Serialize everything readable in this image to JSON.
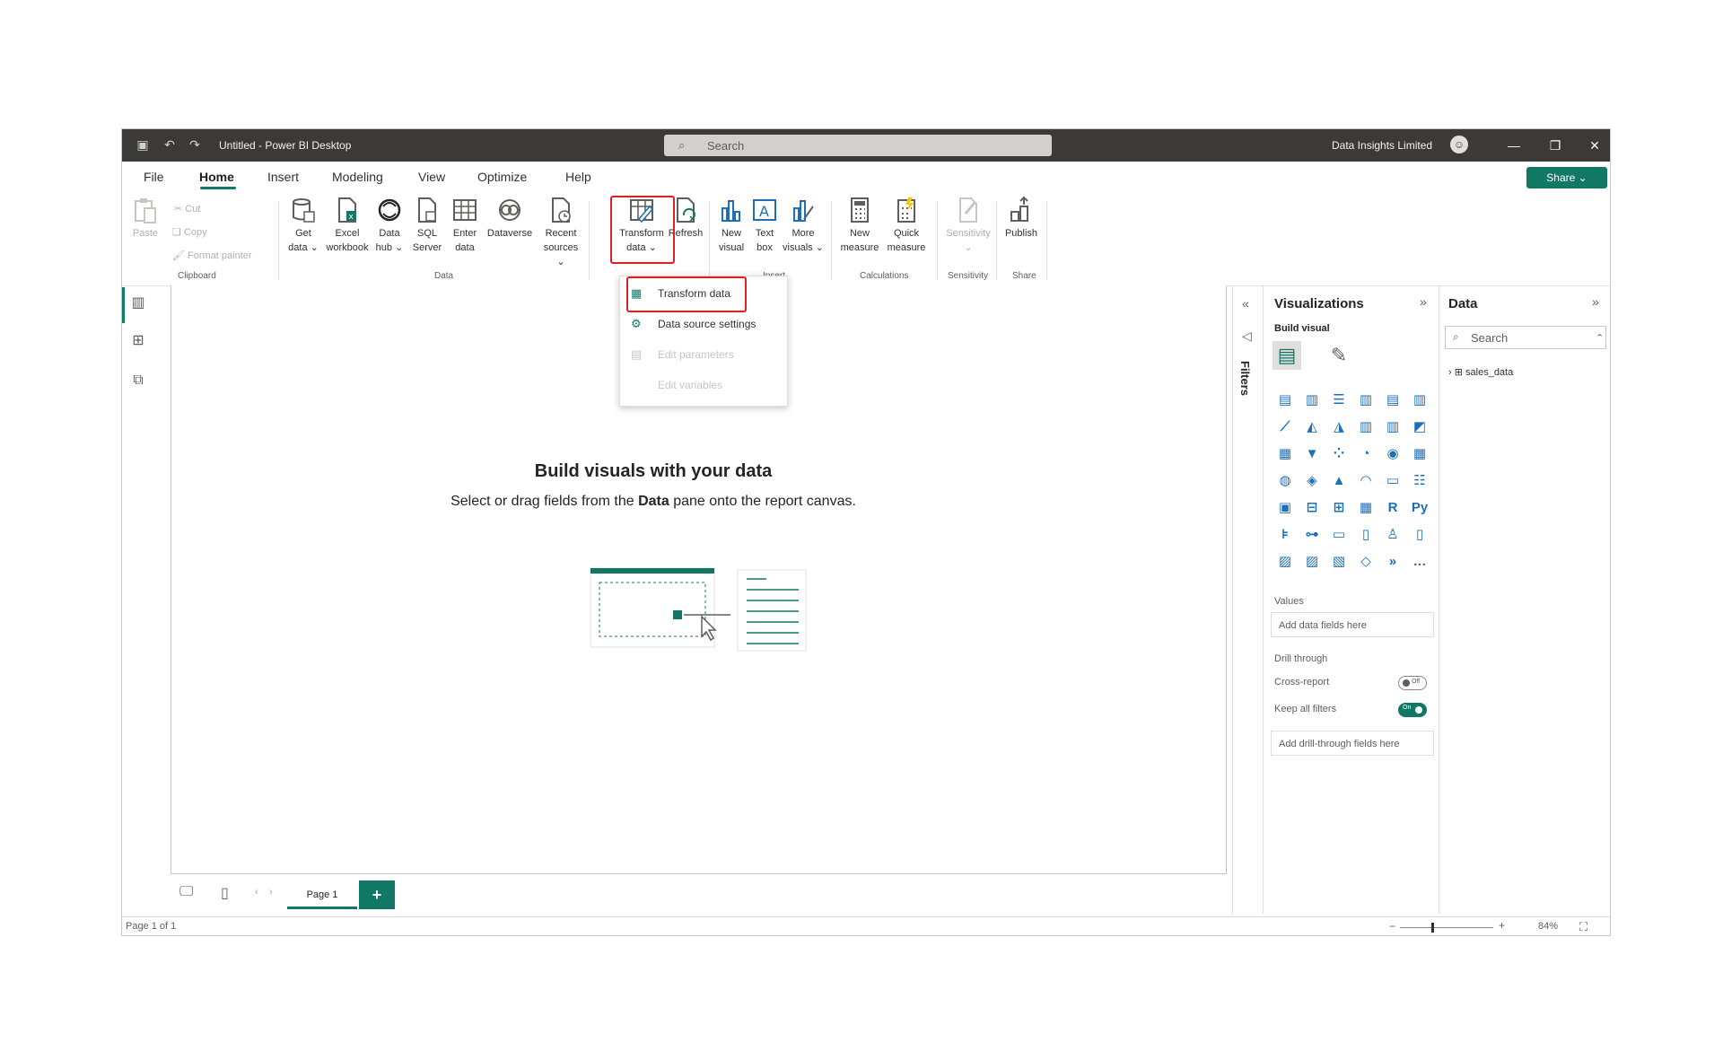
{
  "window": {
    "title": "Untitled - Power BI Desktop",
    "search_placeholder": "Search",
    "user": "Data Insights Limited",
    "share_label": "Share ⌄"
  },
  "menu": [
    "File",
    "Home",
    "Insert",
    "Modeling",
    "View",
    "Optimize",
    "Help"
  ],
  "ribbon": {
    "clipboard": {
      "paste": "Paste",
      "cut": "Cut",
      "copy": "Copy",
      "format_painter": "Format painter",
      "group": "Clipboard"
    },
    "data": {
      "get_data": [
        "Get",
        "data ⌄"
      ],
      "excel": [
        "Excel",
        "workbook"
      ],
      "data_hub": [
        "Data",
        "hub ⌄"
      ],
      "sql": [
        "SQL",
        "Server"
      ],
      "enter": [
        "Enter",
        "data"
      ],
      "dataverse": [
        "Dataverse",
        ""
      ],
      "recent": [
        "Recent",
        "sources ⌄"
      ],
      "group": "Data"
    },
    "queries": {
      "transform": [
        "Transform",
        "data ⌄"
      ],
      "refresh": [
        "Refresh",
        ""
      ]
    },
    "insert": {
      "new_visual": [
        "New",
        "visual"
      ],
      "text_box": [
        "Text",
        "box"
      ],
      "more_visuals": [
        "More",
        "visuals ⌄"
      ],
      "group": "Insert"
    },
    "calculations": {
      "new_measure": [
        "New",
        "measure"
      ],
      "quick_measure": [
        "Quick",
        "measure"
      ],
      "group": "Calculations"
    },
    "sensitivity": {
      "label": [
        "Sensitivity",
        "⌄"
      ],
      "group": "Sensitivity"
    },
    "share": {
      "publish": [
        "Publish",
        ""
      ],
      "group": "Share"
    }
  },
  "dropdown": {
    "items": [
      {
        "label": "Transform data",
        "disabled": false
      },
      {
        "label": "Data source settings",
        "disabled": false
      },
      {
        "label": "Edit parameters",
        "disabled": true
      },
      {
        "label": "Edit variables",
        "disabled": true
      }
    ]
  },
  "canvas": {
    "title": "Build visuals with your data",
    "subtitle_pre": "Select or drag fields from the ",
    "subtitle_bold": "Data",
    "subtitle_post": " pane onto the report canvas."
  },
  "filters": {
    "label": "Filters"
  },
  "visualizations": {
    "title": "Visualizations",
    "build_visual": "Build visual",
    "values_label": "Values",
    "values_placeholder": "Add data fields here",
    "drill_through": "Drill through",
    "cross_report": "Cross-report",
    "cross_report_state": "Off",
    "keep_filters": "Keep all filters",
    "keep_filters_state": "On",
    "drill_placeholder": "Add drill-through fields here",
    "r_label": "R",
    "py_label": "Py"
  },
  "data_pane": {
    "title": "Data",
    "search_placeholder": "Search",
    "table": "sales_data"
  },
  "pages": {
    "tab": "Page 1",
    "add": "+"
  },
  "status": {
    "page_info": "Page 1 of 1",
    "zoom": "84%",
    "zoom_fraction": 0.35
  },
  "colors": {
    "accent": "#117865",
    "highlight": "#e01f1f",
    "titlebar": "#3b3a39"
  }
}
